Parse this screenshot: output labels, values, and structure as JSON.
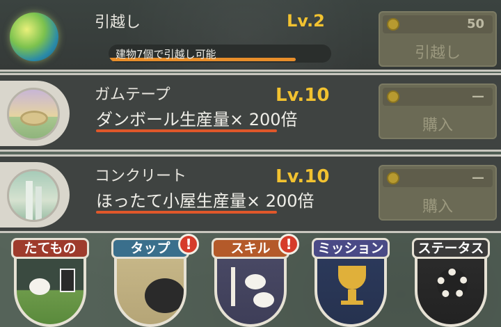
{
  "rows": [
    {
      "name": "引越し",
      "level": "Lv.2",
      "progress_text": "建物7個で引越し可能",
      "progress": 0.84,
      "cost": "50",
      "button_label": "引越し"
    },
    {
      "name": "ガムテープ",
      "level": "Lv.10",
      "effect": "ダンボール生産量× 200倍",
      "cost": "—",
      "button_label": "購入"
    },
    {
      "name": "コンクリート",
      "level": "Lv.10",
      "effect": "ほったて小屋生産量× 200倍",
      "cost": "—",
      "button_label": "購入"
    }
  ],
  "nav": [
    {
      "label": "たてもの",
      "color": "#9e3b2c",
      "alert": false
    },
    {
      "label": "タップ",
      "color": "#3a6f8c",
      "alert": true,
      "alert_text": "!"
    },
    {
      "label": "スキル",
      "color": "#b45a2a",
      "alert": true,
      "alert_text": "!"
    },
    {
      "label": "ミッション",
      "color": "#4a4a86",
      "alert": false
    },
    {
      "label": "ステータス",
      "color": "#3a3a3a",
      "alert": false
    }
  ]
}
